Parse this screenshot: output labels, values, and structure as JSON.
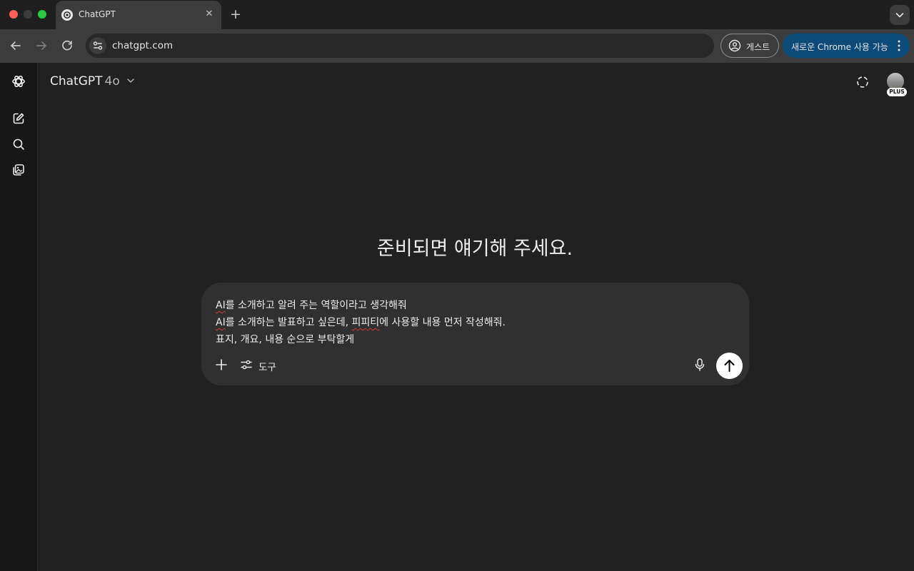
{
  "browser": {
    "tab": {
      "title": "ChatGPT",
      "favicon": "chatgpt-logo-icon",
      "close_glyph": "✕"
    },
    "new_tab_glyph": "+",
    "address": {
      "url": "chatgpt.com"
    },
    "profile": {
      "label": "게스트",
      "icon": "account-circle-icon"
    },
    "update": {
      "label": "새로운 Chrome 사용 가능",
      "icon": "more-vert-icon",
      "color": "#0b4a79"
    }
  },
  "chatgpt": {
    "sidebar": {
      "items": [
        {
          "name": "openai-logo-icon"
        },
        {
          "name": "new-chat-icon"
        },
        {
          "name": "search-icon"
        },
        {
          "name": "library-icon"
        }
      ]
    },
    "header": {
      "model_name": "ChatGPT",
      "model_version": "4o",
      "plan_badge": "PLUS"
    },
    "headline": "준비되면 얘기해 주세요.",
    "composer": {
      "lines": [
        {
          "pre": "",
          "flag": "AI",
          "post": "를 소개하고 알려 주는 역할이라고 생각해줘"
        },
        {
          "pre": "",
          "flag": "AI",
          "mid": "를 소개하는 발표하고 싶은데, ",
          "flag2": "피피티",
          "post": "에 사용할 내용 먼저 작성해줘."
        },
        {
          "pre": "표지, 개요, 내용 순으로 부탁할게"
        }
      ],
      "tools_label": "도구"
    }
  }
}
